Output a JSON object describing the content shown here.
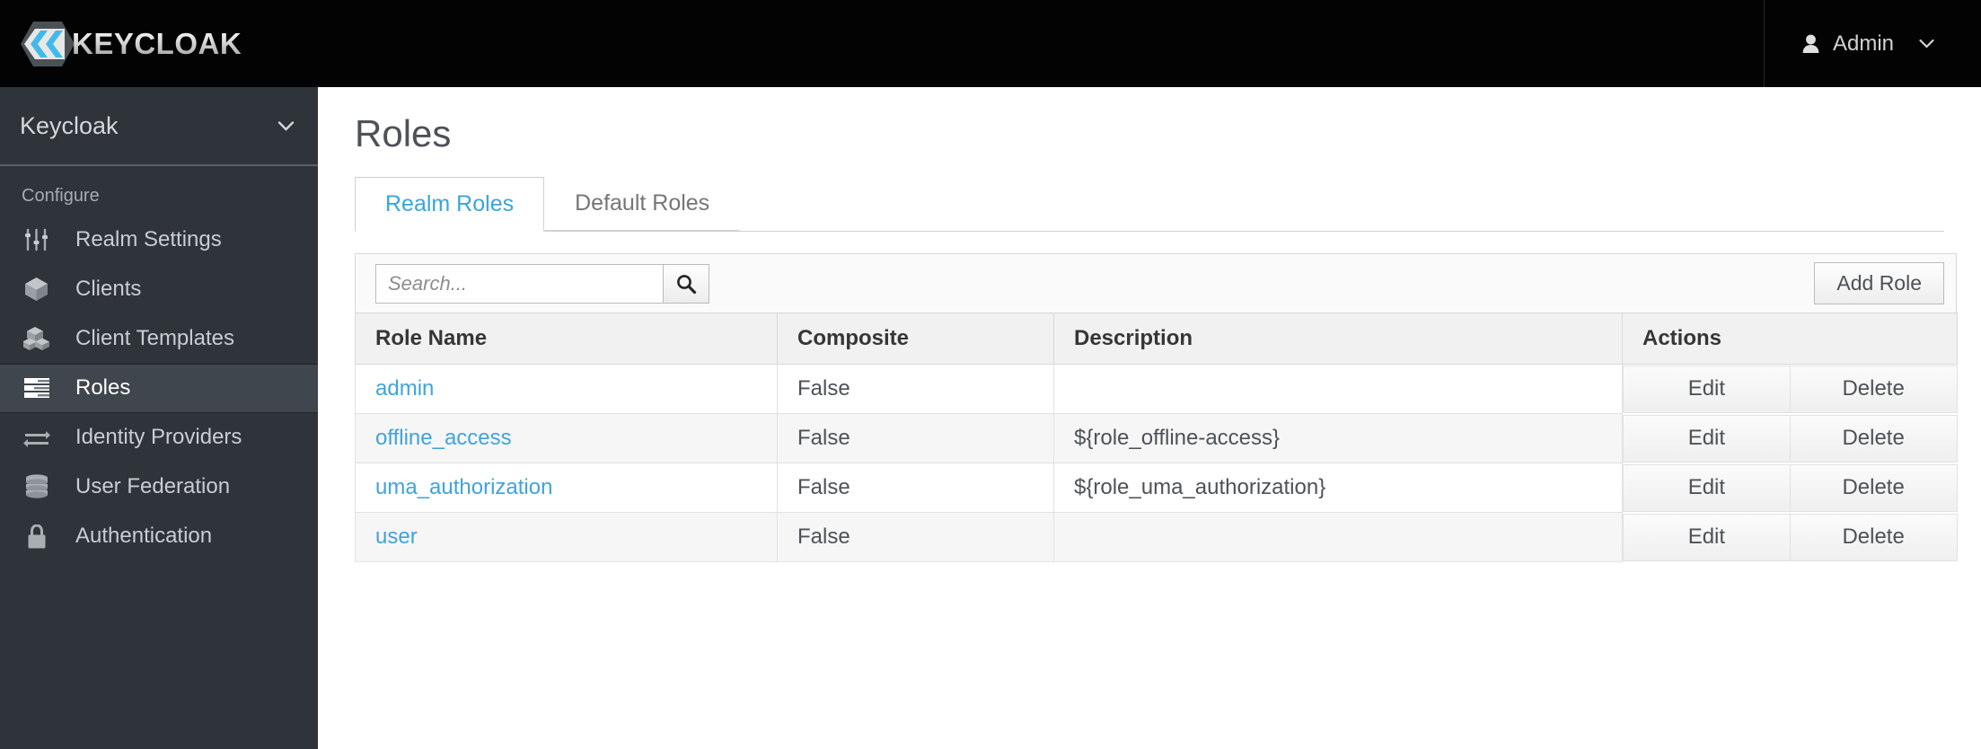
{
  "masthead": {
    "brand_text": "KEYCLOAK",
    "logo_icon": "keycloak-hexagon-logo",
    "user_icon": "user-icon",
    "user_name": "Admin",
    "caret_icon": "chevron-down-icon"
  },
  "sidebar": {
    "realm": {
      "name": "Keycloak",
      "caret_icon": "chevron-down-icon"
    },
    "section_title": "Configure",
    "items": [
      {
        "label": "Realm Settings",
        "icon": "sliders-icon",
        "active": false
      },
      {
        "label": "Clients",
        "icon": "cube-icon",
        "active": false
      },
      {
        "label": "Client Templates",
        "icon": "stacked-cubes-icon",
        "active": false
      },
      {
        "label": "Roles",
        "icon": "list-rows-icon",
        "active": true
      },
      {
        "label": "Identity Providers",
        "icon": "exchange-arrows-icon",
        "active": false
      },
      {
        "label": "User Federation",
        "icon": "database-icon",
        "active": false
      },
      {
        "label": "Authentication",
        "icon": "lock-icon",
        "active": false
      }
    ]
  },
  "main": {
    "page_title": "Roles",
    "tabs": [
      {
        "label": "Realm Roles",
        "active": true
      },
      {
        "label": "Default Roles",
        "active": false
      }
    ],
    "toolbar": {
      "search_placeholder": "Search...",
      "search_value": "",
      "search_icon": "search-icon",
      "add_role_label": "Add Role"
    },
    "table": {
      "columns": [
        "Role Name",
        "Composite",
        "Description",
        "Actions"
      ],
      "actions": {
        "edit_label": "Edit",
        "delete_label": "Delete"
      },
      "rows": [
        {
          "name": "admin",
          "composite": "False",
          "description": ""
        },
        {
          "name": "offline_access",
          "composite": "False",
          "description": "${role_offline-access}"
        },
        {
          "name": "uma_authorization",
          "composite": "False",
          "description": "${role_uma_authorization}"
        },
        {
          "name": "user",
          "composite": "False",
          "description": ""
        }
      ]
    }
  },
  "colors": {
    "masthead_bg": "#030303",
    "sidebar_bg": "#2e3439",
    "sidebar_active_bg": "#3f464d",
    "link_blue": "#40a3dd",
    "tab_active_blue": "#39a5dc",
    "logo_accent": "#43b9e9"
  }
}
